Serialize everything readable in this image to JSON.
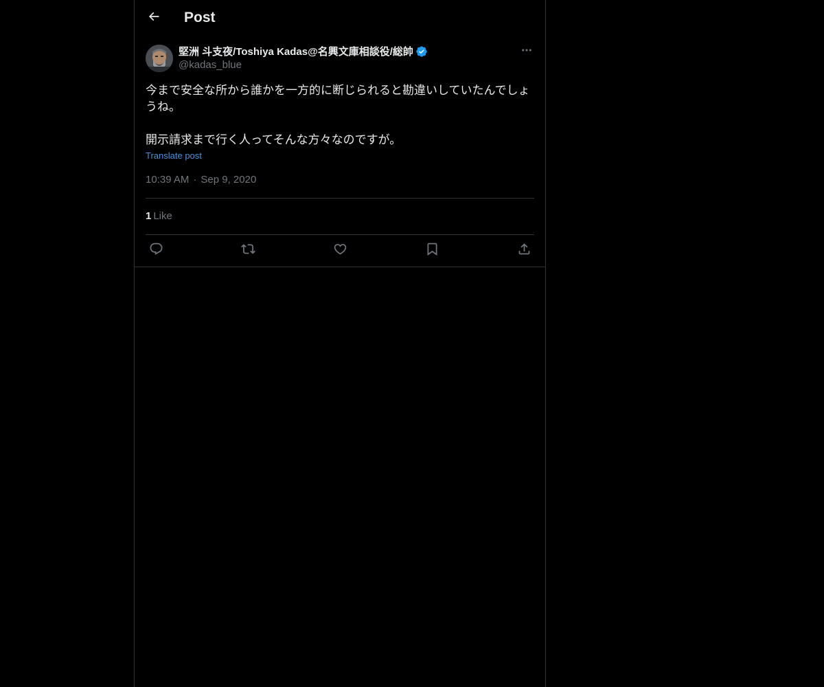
{
  "header": {
    "title": "Post"
  },
  "post": {
    "author": {
      "display_name": "堅洲 斗支夜/Toshiya Kadas@名興文庫相談役/総帥",
      "handle": "@kadas_blue",
      "verified": true
    },
    "text_lines": [
      "今まで安全な所から誰かを一方的に断じられると勘違いしていたんでしょうね。",
      "開示請求まで行く人ってそんな方々なのですが。"
    ],
    "translate_label": "Translate post",
    "time": "10:39 AM",
    "separator": "·",
    "date": "Sep 9, 2020",
    "likes_count": "1",
    "likes_label": "Like"
  },
  "icons": {
    "back": "arrow-left-icon",
    "verified": "verified-badge-icon",
    "more": "more-icon",
    "reply": "reply-icon",
    "repost": "repost-icon",
    "like": "heart-icon",
    "bookmark": "bookmark-icon",
    "share": "share-icon"
  },
  "colors": {
    "background": "#000000",
    "text": "#e7e9ea",
    "secondary_text": "#71767b",
    "accent": "#1d9bf0",
    "link": "#4f8fd8",
    "border": "#2f3336"
  }
}
